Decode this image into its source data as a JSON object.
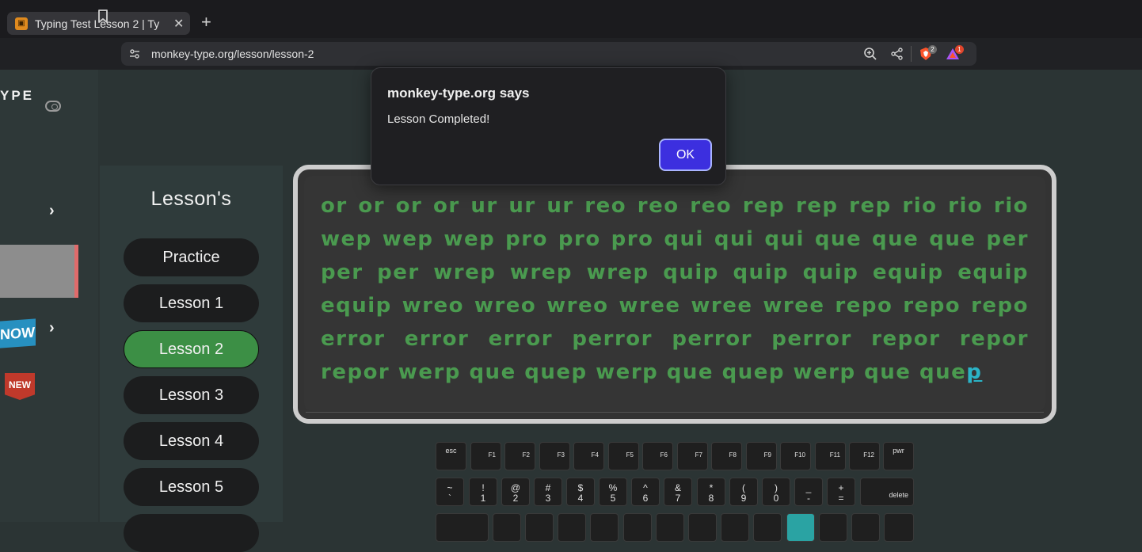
{
  "browser": {
    "tab_title": "Typing Test Lesson 2 | Ty",
    "new_tab_label": "+",
    "url": "monkey-type.org/lesson/lesson-2",
    "shield_badge": "2",
    "rewards_badge": "1"
  },
  "sidebar": {
    "brand": "YPE",
    "now_label": "NOW",
    "new_label": "NEW"
  },
  "lessons": {
    "heading": "Lesson's",
    "items": [
      "Practice",
      "Lesson 1",
      "Lesson 2",
      "Lesson 3",
      "Lesson 4",
      "Lesson 5"
    ],
    "active": "Lesson 2"
  },
  "typing": {
    "completed_text": "or or or or ur ur ur reo reo reo rep rep rep rio rio rio wep wep wep pro pro pro qui qui qui que que que per per per wrep wrep wrep quip quip quip equip equip equip wreo wreo wreo wree wree wree repo repo repo error error error perror perror perror repor repor repor werp que quep werp que quep werp que que",
    "current_char": "p"
  },
  "keyboard": {
    "fn_row": [
      "esc",
      "F1",
      "F2",
      "F3",
      "F4",
      "F5",
      "F6",
      "F7",
      "F8",
      "F9",
      "F10",
      "F11",
      "F12",
      "pwr"
    ],
    "number_row": [
      {
        "top": "~",
        "bottom": "`"
      },
      {
        "top": "!",
        "bottom": "1"
      },
      {
        "top": "@",
        "bottom": "2"
      },
      {
        "top": "#",
        "bottom": "3"
      },
      {
        "top": "$",
        "bottom": "4"
      },
      {
        "top": "%",
        "bottom": "5"
      },
      {
        "top": "^",
        "bottom": "6"
      },
      {
        "top": "&",
        "bottom": "7"
      },
      {
        "top": "*",
        "bottom": "8"
      },
      {
        "top": "(",
        "bottom": "9"
      },
      {
        "top": ")",
        "bottom": "0"
      },
      {
        "top": "_",
        "bottom": "-"
      },
      {
        "top": "+",
        "bottom": "="
      }
    ],
    "delete_label": "delete",
    "highlight_color": "#2aa3a3"
  },
  "dialog": {
    "title": "monkey-type.org says",
    "message": "Lesson Completed!",
    "ok_label": "OK"
  },
  "colors": {
    "typed_text": "#4a9a4f",
    "current_char": "#2bb3c6",
    "active_lesson": "#3c8f45",
    "ok_button": "#3c2fdf"
  }
}
